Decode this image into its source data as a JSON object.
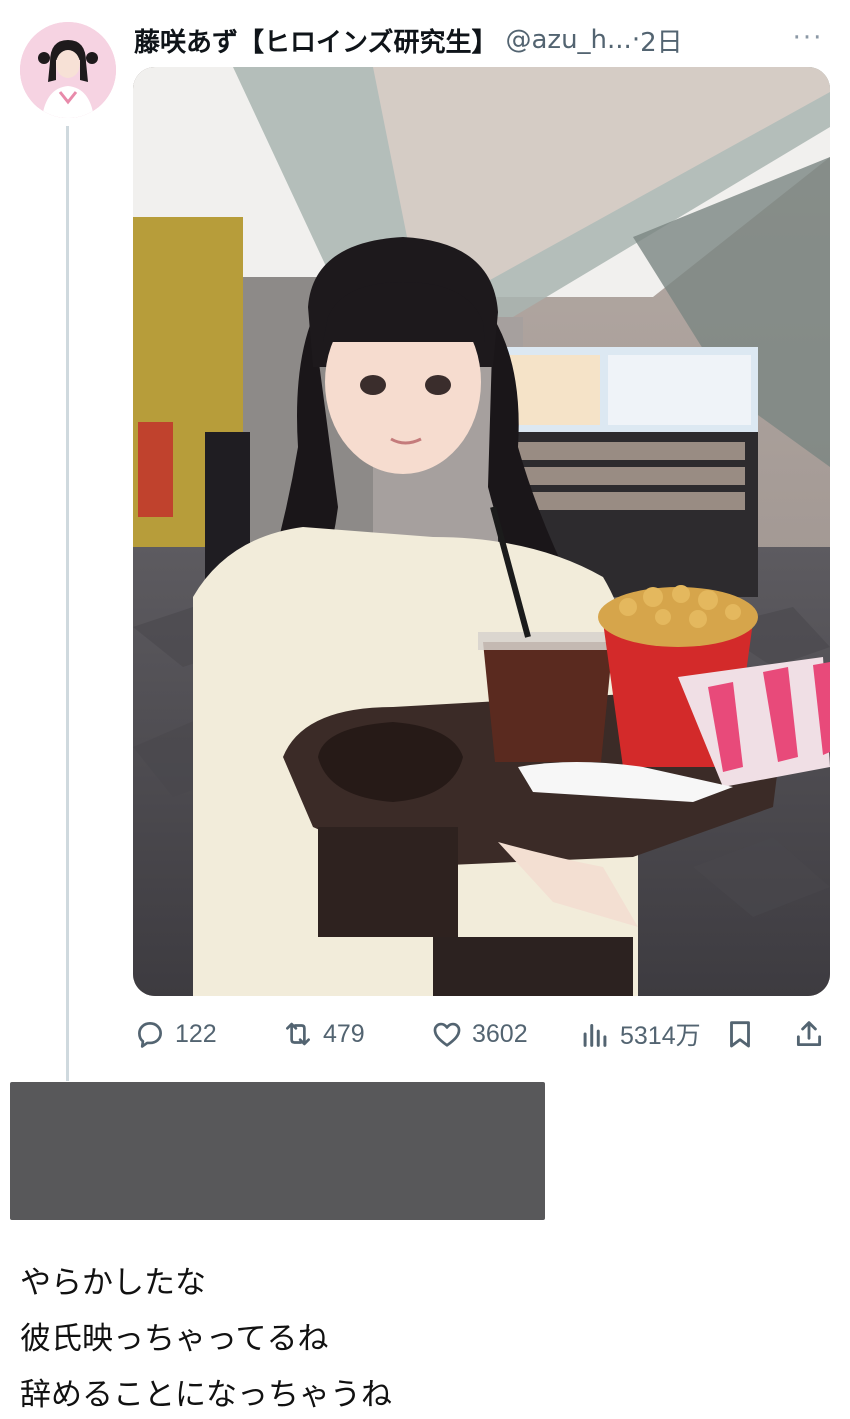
{
  "post": {
    "display_name": "藤咲あず【ヒロインズ研究生】",
    "handle": "@azu_h...",
    "separator": "·",
    "time": "2日",
    "more_label": "···"
  },
  "actions": {
    "replies": "122",
    "retweets": "479",
    "likes": "3602",
    "views": "5314万"
  },
  "comment": {
    "lines": [
      "やらかしたな",
      "彼氏映っちゃってるね",
      "辞めることになっちゃうね"
    ]
  },
  "colors": {
    "text": "#0f1419",
    "secondary": "#536471",
    "thread_line": "#cfd9de",
    "redaction": "#58585a"
  },
  "icons": {
    "reply": "speech-bubble-icon",
    "retweet": "retweet-arrows-icon",
    "like": "heart-icon",
    "views": "bar-chart-icon",
    "bookmark": "bookmark-icon",
    "share": "share-upload-icon",
    "more": "ellipsis-icon"
  }
}
